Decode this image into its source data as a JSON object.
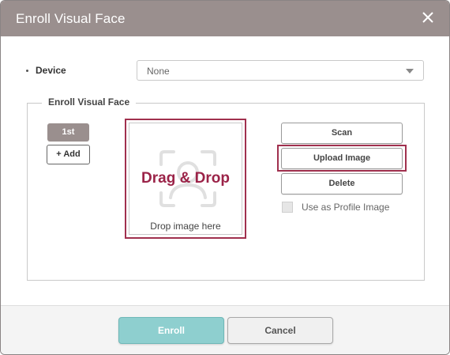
{
  "dialog": {
    "title": "Enroll Visual Face",
    "close_icon": "close-icon"
  },
  "device": {
    "label": "Device",
    "selected": "None",
    "arrow_icon": "chevron-down-icon"
  },
  "enroll_section": {
    "legend": "Enroll Visual Face",
    "slots": [
      "1st"
    ],
    "add_label": "+ Add",
    "drop_zone": {
      "icon": "face-scan-icon",
      "title": "Drag & Drop",
      "hint": "Drop image here"
    },
    "actions": {
      "scan": "Scan",
      "upload": "Upload Image",
      "delete": "Delete"
    },
    "profile_checkbox": {
      "label": "Use as Profile Image",
      "checked": false
    }
  },
  "footer": {
    "enroll": "Enroll",
    "cancel": "Cancel"
  },
  "colors": {
    "titlebar": "#9a8f8e",
    "highlight": "#a0304e",
    "drag_text": "#9b2348",
    "primary_button": "#8ecfcf"
  }
}
